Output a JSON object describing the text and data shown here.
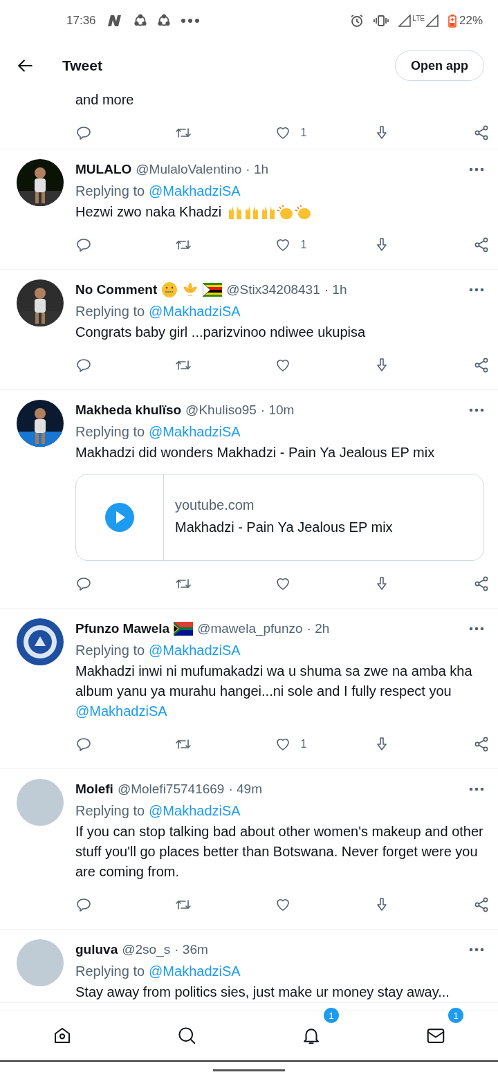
{
  "status_bar": {
    "time": "17:36",
    "network": "LTE",
    "battery": "22%"
  },
  "header": {
    "title": "Tweet",
    "open_app": "Open app"
  },
  "tweets": [
    {
      "kind": "partial",
      "body": "and more",
      "like_count": "1"
    },
    {
      "kind": "full",
      "avatar": {
        "kind": "picture"
      },
      "name": "MULALO",
      "handle": "@MulaloValentino",
      "time": "· 1h",
      "replying": "Replying to",
      "reply_to": "@MakhadziSA",
      "body": "Hezwi zwo naka Khadzi",
      "body_emojis": [
        {
          "kind": "raised-hands"
        },
        {
          "kind": "raised-hands"
        },
        {
          "kind": "raised-hands"
        },
        {
          "kind": "clap"
        },
        {
          "kind": "clap"
        }
      ],
      "like_count": "1"
    },
    {
      "kind": "full",
      "avatar": {
        "kind": "picture"
      },
      "name": "No Comment",
      "name_badges": [
        {
          "kind": "zipper-face"
        },
        {
          "kind": "fleur"
        },
        {
          "kind": "zimbabwe-flag"
        }
      ],
      "handle": "@Stix34208431",
      "time": "· 1h",
      "replying": "Replying to",
      "reply_to": "@MakhadziSA",
      "body": "Congrats baby girl ...parizvinoo ndiwee ukupisa"
    },
    {
      "kind": "full",
      "avatar": {
        "kind": "picture"
      },
      "name": "Makheda khulïso",
      "handle": "@Khuliso95",
      "time": "· 10m",
      "replying": "Replying to",
      "reply_to": "@MakhadziSA",
      "body": "Makhadzi did wonders Makhadzi - Pain Ya Jealous EP mix",
      "card": {
        "domain": "youtube.com",
        "title": "Makhadzi - Pain Ya Jealous EP mix"
      }
    },
    {
      "kind": "full",
      "avatar": {
        "kind": "logo"
      },
      "name": "Pfunzo Mawela",
      "name_badges": [
        {
          "kind": "south-africa-flag"
        }
      ],
      "handle": "@mawela_pfunzo",
      "time": "· 2h",
      "replying": "Replying to",
      "reply_to": "@MakhadziSA",
      "body": "Makhadzi inwi ni mufumakadzi wa u shuma sa zwe na amba kha album yanu ya murahu hangei...ni sole and I fully respect you",
      "body_mention": "@MakhadziSA",
      "like_count": "1"
    },
    {
      "kind": "full",
      "avatar": {
        "kind": "blank"
      },
      "name": "Molefi",
      "handle": "@Molefi75741669",
      "time": "· 49m",
      "replying": "Replying to",
      "reply_to": "@MakhadziSA",
      "body": "If you can stop talking bad about other women's makeup and other stuff you'll go places better than Botswana. Never forget were you are coming from."
    },
    {
      "kind": "cut",
      "avatar": {
        "kind": "blank"
      },
      "name": "guluva",
      "handle": "@2so_s",
      "time": "· 36m",
      "replying": "Replying to",
      "reply_to": "@MakhadziSA",
      "body": "Stay away from politics sies, just make ur money stay away..."
    }
  ],
  "bottom_nav": [
    {
      "kind": "home"
    },
    {
      "kind": "search"
    },
    {
      "kind": "bell",
      "badge": "1"
    },
    {
      "kind": "mail",
      "badge": "1"
    }
  ]
}
